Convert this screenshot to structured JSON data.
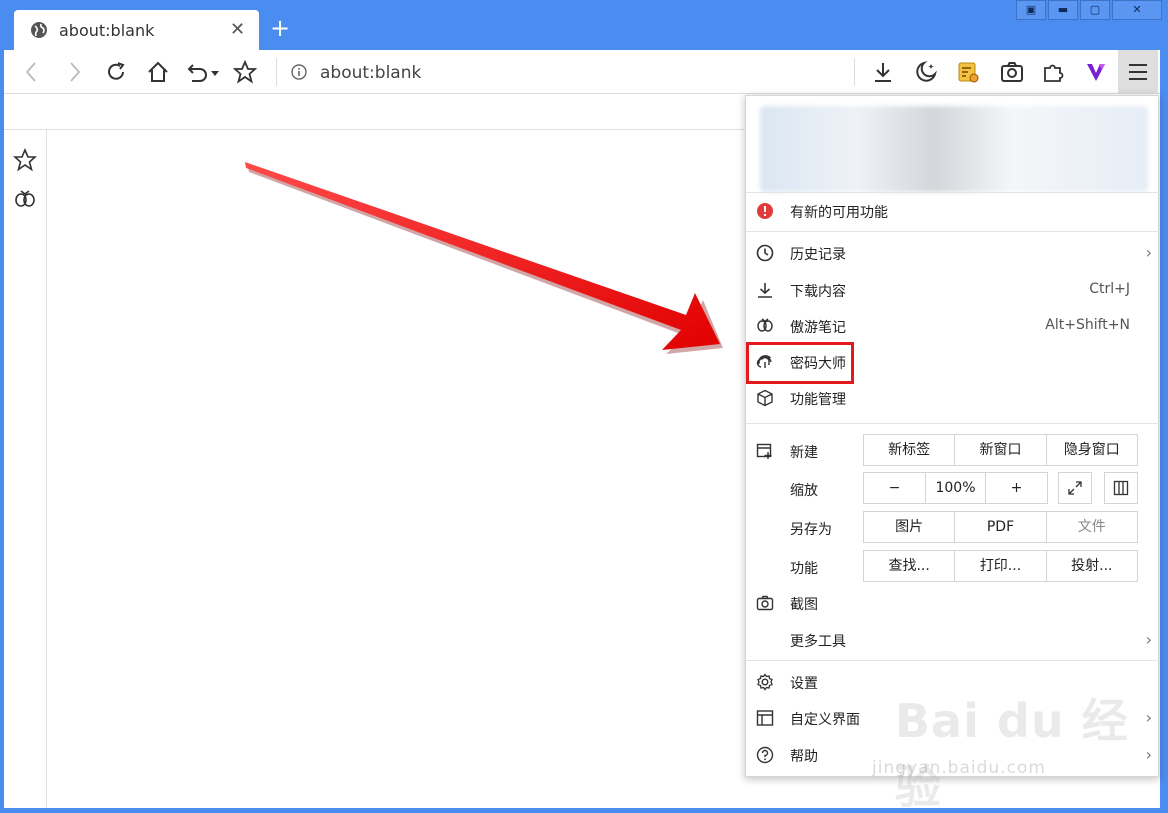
{
  "tab": {
    "title": "about:blank",
    "close": "✕",
    "new_tab": "+"
  },
  "address_bar": {
    "url": "about:blank"
  },
  "window_controls": {
    "layout": "▣",
    "minimize": "▬",
    "maximize": "▢",
    "close": "✕"
  },
  "menu": {
    "notice": "有新的可用功能",
    "items": [
      {
        "label": "历史记录",
        "icon": "clock-icon",
        "shortcut": "",
        "chevron": "›"
      },
      {
        "label": "下载内容",
        "icon": "download-icon",
        "shortcut": "Ctrl+J",
        "chevron": ""
      },
      {
        "label": "傲游笔记",
        "icon": "notes-icon",
        "shortcut": "Alt+Shift+N",
        "chevron": ""
      },
      {
        "label": "密码大师",
        "icon": "fingerprint-icon",
        "shortcut": "",
        "chevron": ""
      },
      {
        "label": "功能管理",
        "icon": "cube-icon",
        "shortcut": "",
        "chevron": ""
      }
    ],
    "new": {
      "label": "新建",
      "buttons": [
        "新标签",
        "新窗口",
        "隐身窗口"
      ]
    },
    "zoom": {
      "label": "缩放",
      "minus": "−",
      "value": "100%",
      "plus": "+"
    },
    "save_as": {
      "label": "另存为",
      "buttons": [
        "图片",
        "PDF",
        "文件"
      ]
    },
    "functions": {
      "label": "功能",
      "buttons": [
        "查找...",
        "打印...",
        "投射..."
      ]
    },
    "screenshot": "截图",
    "more_tools": "更多工具",
    "settings": "设置",
    "customize": "自定义界面",
    "help": "帮助",
    "chevron": "›"
  },
  "watermark": {
    "brand": "Bai du 经验",
    "url": "jingyan.baidu.com"
  },
  "colors": {
    "titlebar": "#4a8cf0",
    "highlight": "#e3191b",
    "notice_icon": "#e03a3a"
  }
}
